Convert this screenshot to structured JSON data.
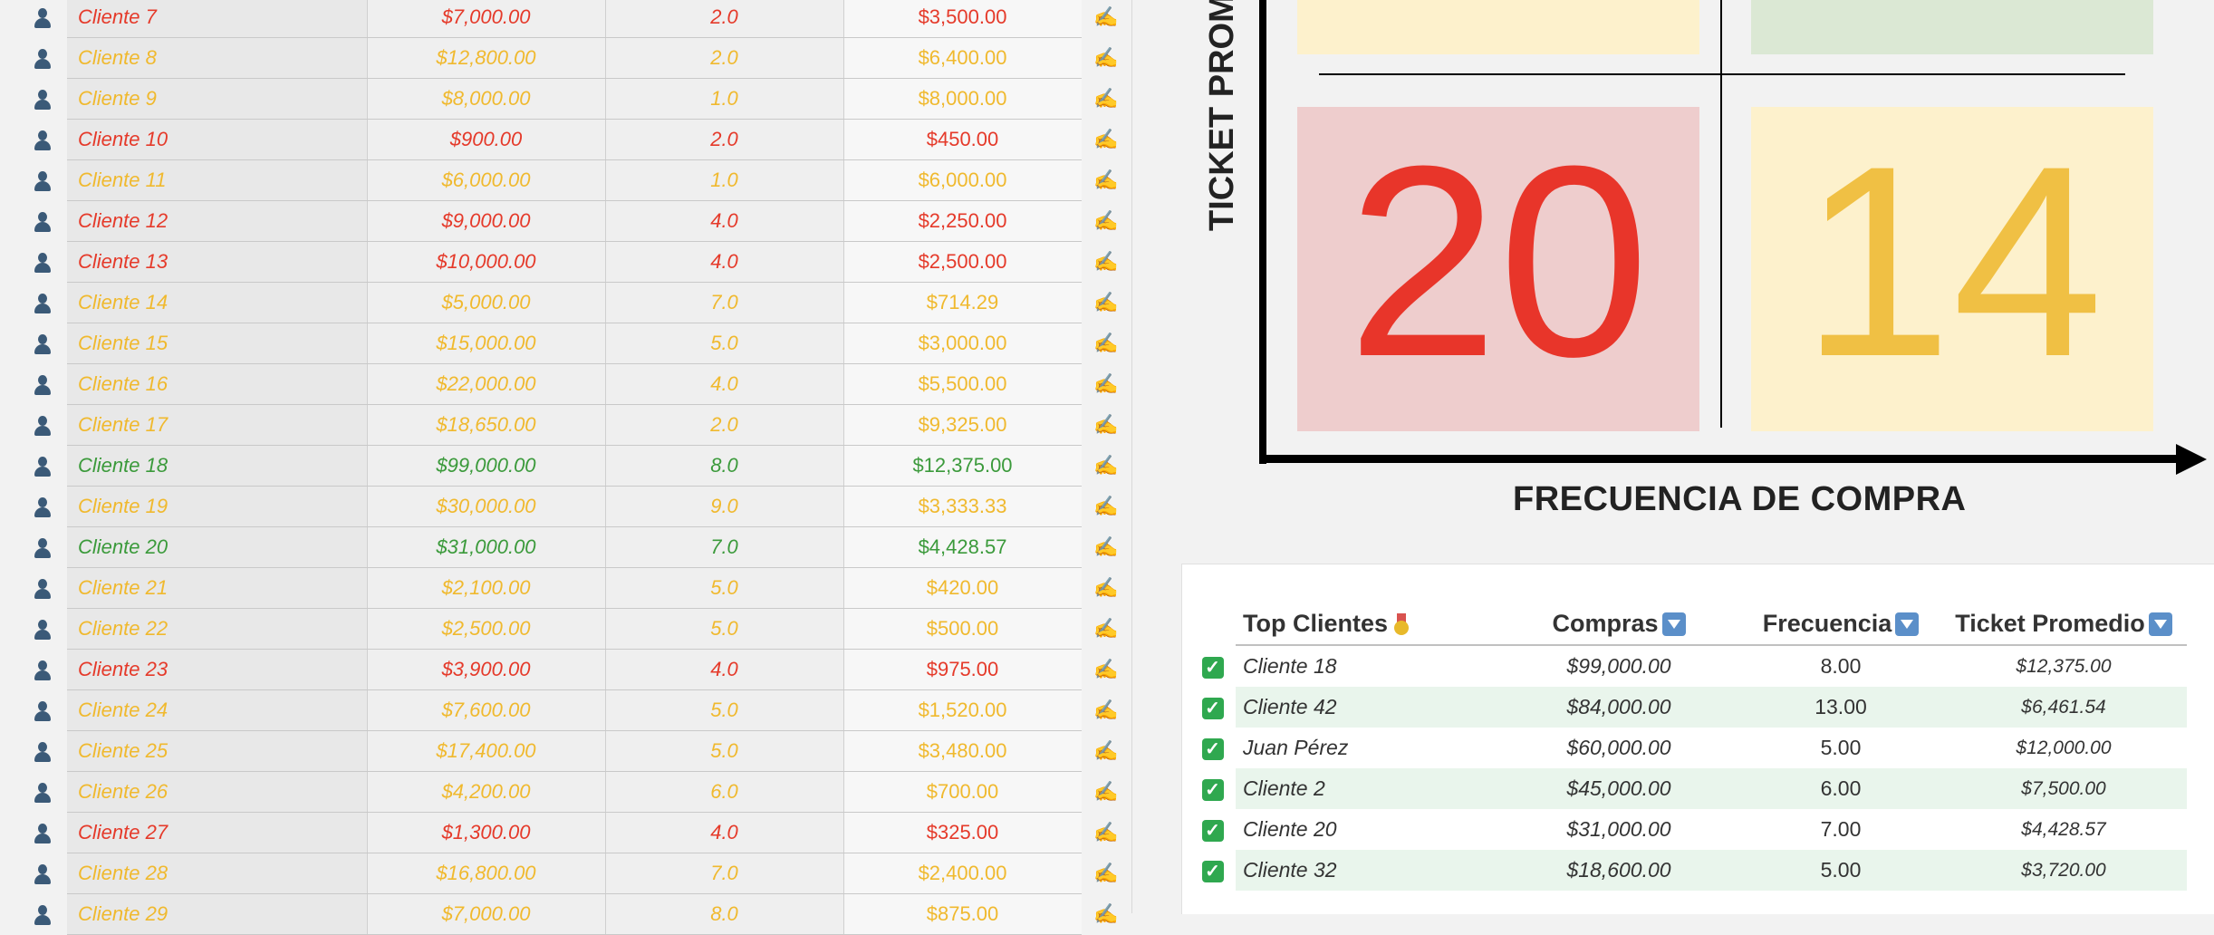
{
  "clients": [
    {
      "name": "Cliente 7",
      "compras": "$7,000.00",
      "freq": "2.0",
      "ticket": "$3,500.00",
      "status": "red"
    },
    {
      "name": "Cliente 8",
      "compras": "$12,800.00",
      "freq": "2.0",
      "ticket": "$6,400.00",
      "status": "yellow"
    },
    {
      "name": "Cliente 9",
      "compras": "$8,000.00",
      "freq": "1.0",
      "ticket": "$8,000.00",
      "status": "yellow"
    },
    {
      "name": "Cliente 10",
      "compras": "$900.00",
      "freq": "2.0",
      "ticket": "$450.00",
      "status": "red"
    },
    {
      "name": "Cliente 11",
      "compras": "$6,000.00",
      "freq": "1.0",
      "ticket": "$6,000.00",
      "status": "yellow"
    },
    {
      "name": "Cliente 12",
      "compras": "$9,000.00",
      "freq": "4.0",
      "ticket": "$2,250.00",
      "status": "red"
    },
    {
      "name": "Cliente 13",
      "compras": "$10,000.00",
      "freq": "4.0",
      "ticket": "$2,500.00",
      "status": "red"
    },
    {
      "name": "Cliente 14",
      "compras": "$5,000.00",
      "freq": "7.0",
      "ticket": "$714.29",
      "status": "yellow"
    },
    {
      "name": "Cliente 15",
      "compras": "$15,000.00",
      "freq": "5.0",
      "ticket": "$3,000.00",
      "status": "yellow"
    },
    {
      "name": "Cliente 16",
      "compras": "$22,000.00",
      "freq": "4.0",
      "ticket": "$5,500.00",
      "status": "yellow"
    },
    {
      "name": "Cliente 17",
      "compras": "$18,650.00",
      "freq": "2.0",
      "ticket": "$9,325.00",
      "status": "yellow"
    },
    {
      "name": "Cliente 18",
      "compras": "$99,000.00",
      "freq": "8.0",
      "ticket": "$12,375.00",
      "status": "green"
    },
    {
      "name": "Cliente 19",
      "compras": "$30,000.00",
      "freq": "9.0",
      "ticket": "$3,333.33",
      "status": "yellow"
    },
    {
      "name": "Cliente 20",
      "compras": "$31,000.00",
      "freq": "7.0",
      "ticket": "$4,428.57",
      "status": "green"
    },
    {
      "name": "Cliente 21",
      "compras": "$2,100.00",
      "freq": "5.0",
      "ticket": "$420.00",
      "status": "yellow"
    },
    {
      "name": "Cliente 22",
      "compras": "$2,500.00",
      "freq": "5.0",
      "ticket": "$500.00",
      "status": "yellow"
    },
    {
      "name": "Cliente 23",
      "compras": "$3,900.00",
      "freq": "4.0",
      "ticket": "$975.00",
      "status": "red"
    },
    {
      "name": "Cliente 24",
      "compras": "$7,600.00",
      "freq": "5.0",
      "ticket": "$1,520.00",
      "status": "yellow"
    },
    {
      "name": "Cliente 25",
      "compras": "$17,400.00",
      "freq": "5.0",
      "ticket": "$3,480.00",
      "status": "yellow"
    },
    {
      "name": "Cliente 26",
      "compras": "$4,200.00",
      "freq": "6.0",
      "ticket": "$700.00",
      "status": "yellow"
    },
    {
      "name": "Cliente 27",
      "compras": "$1,300.00",
      "freq": "4.0",
      "ticket": "$325.00",
      "status": "red"
    },
    {
      "name": "Cliente 28",
      "compras": "$16,800.00",
      "freq": "7.0",
      "ticket": "$2,400.00",
      "status": "yellow"
    },
    {
      "name": "Cliente 29",
      "compras": "$7,000.00",
      "freq": "8.0",
      "ticket": "$875.00",
      "status": "yellow"
    }
  ],
  "quadrant": {
    "y_axis_label": "TICKET PROMEDIO",
    "x_axis_label": "FRECUENCIA  DE COMPRA",
    "bottom_left_count": "20",
    "bottom_right_count": "14",
    "colors": {
      "top_left_fill": "#fdf1cc",
      "top_right_fill": "#dbe8d4",
      "bottom_left_fill": "#eecdcd",
      "bottom_right_fill": "#fdf1cc",
      "bottom_left_text": "#e8352a",
      "bottom_right_text": "#f0c044"
    }
  },
  "top_clients": {
    "headers": {
      "name": "Top Clientes",
      "compras": "Compras",
      "freq": "Frecuencia",
      "ticket": "Ticket Promedio"
    },
    "rows": [
      {
        "name": "Cliente 18",
        "compras": "$99,000.00",
        "freq": "8.00",
        "ticket": "$12,375.00"
      },
      {
        "name": "Cliente 42",
        "compras": "$84,000.00",
        "freq": "13.00",
        "ticket": "$6,461.54"
      },
      {
        "name": "Juan Pérez",
        "compras": "$60,000.00",
        "freq": "5.00",
        "ticket": "$12,000.00"
      },
      {
        "name": "Cliente 2",
        "compras": "$45,000.00",
        "freq": "6.00",
        "ticket": "$7,500.00"
      },
      {
        "name": "Cliente 20",
        "compras": "$31,000.00",
        "freq": "7.00",
        "ticket": "$4,428.57"
      },
      {
        "name": "Cliente 32",
        "compras": "$18,600.00",
        "freq": "5.00",
        "ticket": "$3,720.00"
      }
    ]
  },
  "icons": {
    "row_icon": "user-icon",
    "edit_icon": "pencil-icon",
    "check_icon": "check-icon",
    "medal_icon": "medal-icon",
    "sort_icon": "sort-down-icon"
  }
}
